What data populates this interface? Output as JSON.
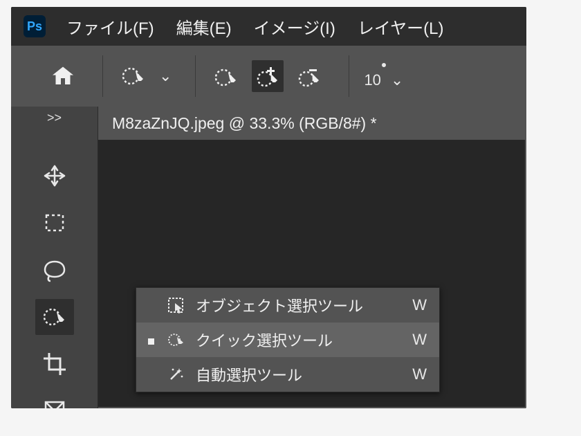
{
  "app": {
    "logo_text": "Ps"
  },
  "menubar": {
    "items": [
      {
        "label": "ファイル(F)"
      },
      {
        "label": "編集(E)"
      },
      {
        "label": "イメージ(I)"
      },
      {
        "label": "レイヤー(L)"
      }
    ]
  },
  "optionsbar": {
    "dropdown_caret": "⌄",
    "brush_size": "10",
    "brush_size_caret": "⌄"
  },
  "sidebar": {
    "collapse_label": ">>",
    "tools": [
      {
        "name": "move-tool"
      },
      {
        "name": "rectangular-marquee-tool"
      },
      {
        "name": "lasso-tool"
      },
      {
        "name": "quick-selection-tool",
        "active": true
      },
      {
        "name": "crop-tool"
      },
      {
        "name": "frame-tool"
      }
    ]
  },
  "document": {
    "tab_title": "M8zaZnJQ.jpeg @ 33.3% (RGB/8#) *"
  },
  "flyout": {
    "items": [
      {
        "label": "オブジェクト選択ツール",
        "shortcut": "W",
        "selected": false,
        "marked": false,
        "icon": "object-selection"
      },
      {
        "label": "クイック選択ツール",
        "shortcut": "W",
        "selected": true,
        "marked": true,
        "icon": "quick-selection"
      },
      {
        "label": "自動選択ツール",
        "shortcut": "W",
        "selected": false,
        "marked": false,
        "icon": "magic-wand"
      }
    ]
  }
}
